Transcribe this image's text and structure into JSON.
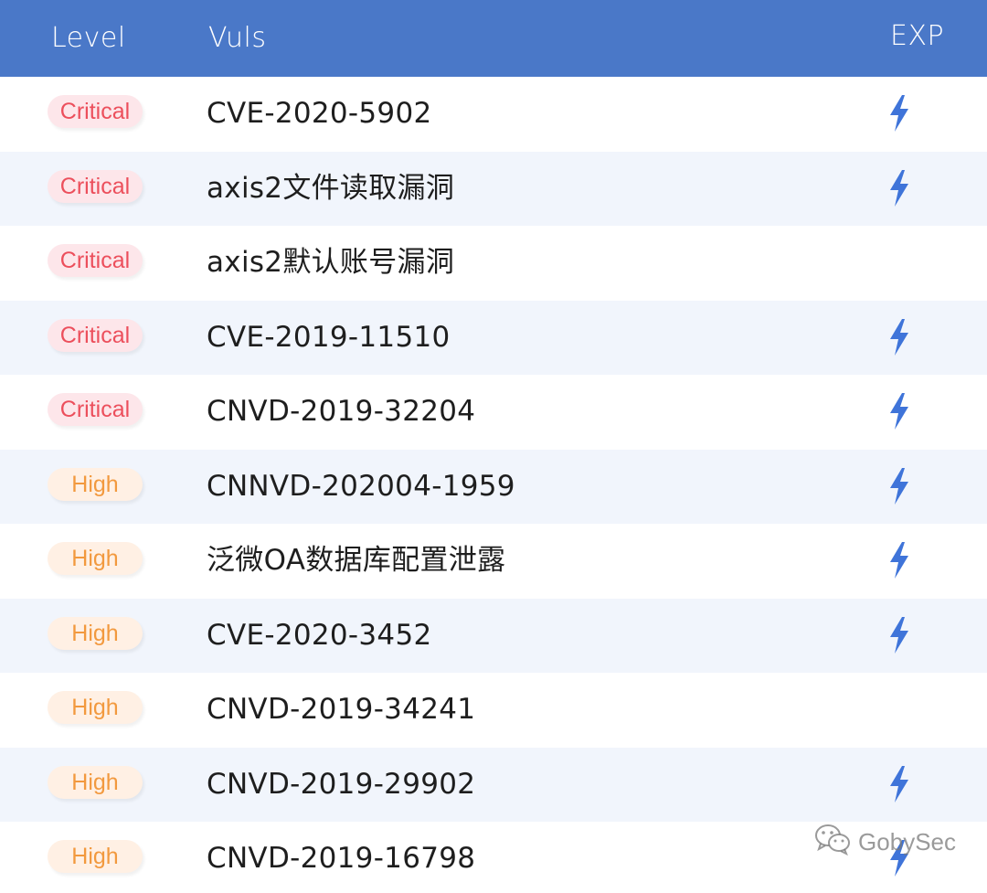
{
  "header": {
    "level": "Level",
    "vuls": "Vuls",
    "exp": "EXP"
  },
  "rows": [
    {
      "level": "Critical",
      "severity": "critical",
      "name": "CVE-2020-5902",
      "exp": true
    },
    {
      "level": "Critical",
      "severity": "critical",
      "name": "axis2文件读取漏洞",
      "exp": true
    },
    {
      "level": "Critical",
      "severity": "critical",
      "name": "axis2默认账号漏洞",
      "exp": false
    },
    {
      "level": "Critical",
      "severity": "critical",
      "name": "CVE-2019-11510",
      "exp": true
    },
    {
      "level": "Critical",
      "severity": "critical",
      "name": "CNVD-2019-32204",
      "exp": true
    },
    {
      "level": "High",
      "severity": "high",
      "name": "CNNVD-202004-1959",
      "exp": true
    },
    {
      "level": "High",
      "severity": "high",
      "name": "泛微OA数据库配置泄露",
      "exp": true
    },
    {
      "level": "High",
      "severity": "high",
      "name": "CVE-2020-3452",
      "exp": true
    },
    {
      "level": "High",
      "severity": "high",
      "name": "CNVD-2019-34241",
      "exp": false
    },
    {
      "level": "High",
      "severity": "high",
      "name": "CNVD-2019-29902",
      "exp": true
    },
    {
      "level": "High",
      "severity": "high",
      "name": "CNVD-2019-16798",
      "exp": true
    }
  ],
  "watermark": {
    "text": "GobySec",
    "icon": "wechat-icon"
  },
  "colors": {
    "header_bg": "#4a78c8",
    "alt_row_bg": "#f1f5fc",
    "critical_text": "#ec4f5c",
    "critical_bg": "#fde6ea",
    "high_text": "#f2993e",
    "high_bg": "#fff0e4",
    "exp_icon": "#3f74d9"
  }
}
